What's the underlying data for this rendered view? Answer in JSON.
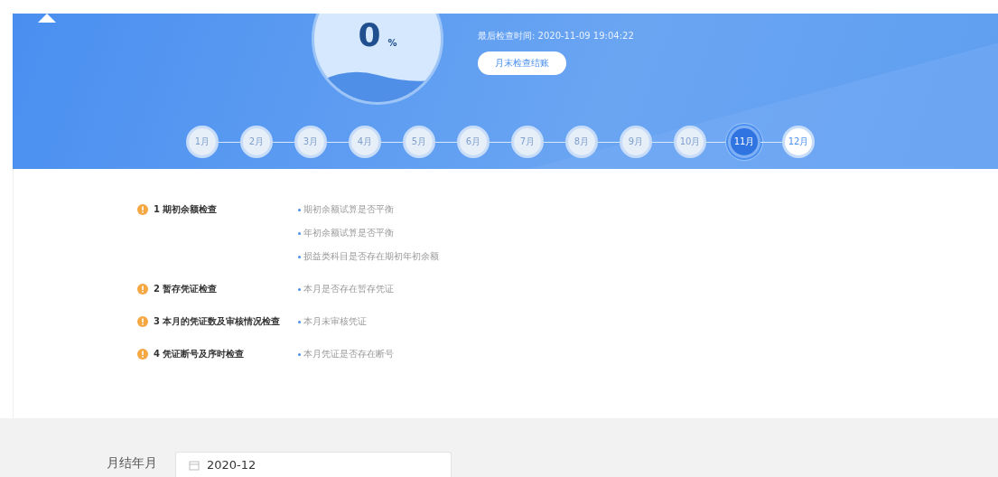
{
  "summary": {
    "percent": "0",
    "unit": "%",
    "last_check_label": "最后检查时间:",
    "last_check_time": "2020-11-09 19:04:22",
    "action_button": "月末检查结账"
  },
  "months": [
    {
      "label": "1月",
      "selected": false,
      "kind": "closed"
    },
    {
      "label": "2月",
      "selected": false,
      "kind": "closed"
    },
    {
      "label": "3月",
      "selected": false,
      "kind": "closed"
    },
    {
      "label": "4月",
      "selected": false,
      "kind": "closed"
    },
    {
      "label": "5月",
      "selected": false,
      "kind": "closed"
    },
    {
      "label": "6月",
      "selected": false,
      "kind": "closed"
    },
    {
      "label": "7月",
      "selected": false,
      "kind": "closed"
    },
    {
      "label": "8月",
      "selected": false,
      "kind": "closed"
    },
    {
      "label": "9月",
      "selected": false,
      "kind": "closed"
    },
    {
      "label": "10月",
      "selected": false,
      "kind": "closed"
    },
    {
      "label": "11月",
      "selected": true,
      "kind": "open"
    },
    {
      "label": "12月",
      "selected": false,
      "kind": "open"
    }
  ],
  "checks": [
    {
      "title": "1 期初余额检查",
      "items": [
        "期初余额试算是否平衡",
        "年初余额试算是否平衡",
        "损益类科目是否存在期初年初余额"
      ]
    },
    {
      "title": "2 暂存凭证检查",
      "items": [
        "本月是否存在暂存凭证"
      ]
    },
    {
      "title": "3 本月的凭证数及审核情况检查",
      "items": [
        "本月未审核凭证"
      ]
    },
    {
      "title": "4 凭证断号及序时检查",
      "items": [
        "本月凭证是否存在断号"
      ]
    }
  ],
  "footer": {
    "label": "月结年月",
    "date_value": "2020-12"
  }
}
